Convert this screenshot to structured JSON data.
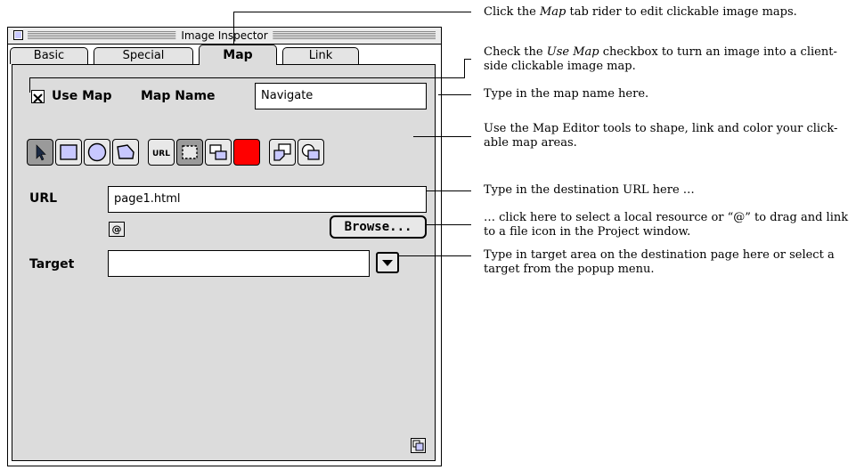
{
  "window": {
    "title": "Image Inspector"
  },
  "tabs": [
    {
      "label": "Basic",
      "active": false
    },
    {
      "label": "Special",
      "active": false
    },
    {
      "label": "Map",
      "active": true
    },
    {
      "label": "Link",
      "active": false
    }
  ],
  "map": {
    "use_map_label": "Use Map",
    "use_map_checked": true,
    "map_name_label": "Map Name",
    "map_name_value": "Navigate"
  },
  "tools": [
    {
      "icon": "arrow-pointer-icon",
      "selected": true
    },
    {
      "icon": "rectangle-icon",
      "selected": false
    },
    {
      "icon": "circle-icon",
      "selected": false
    },
    {
      "icon": "polygon-icon",
      "selected": false
    },
    {
      "icon": "url-icon",
      "label": "URL",
      "selected": false
    },
    {
      "icon": "marquee-icon",
      "selected": true
    },
    {
      "icon": "link-shapes-icon",
      "selected": false
    },
    {
      "icon": "color-swatch-icon",
      "color": "#ff0000",
      "selected": false
    },
    {
      "icon": "bring-to-front-icon",
      "selected": false
    },
    {
      "icon": "send-to-back-icon",
      "selected": false
    }
  ],
  "link": {
    "url_label": "URL",
    "url_value": "page1.html",
    "at_button_label": "@",
    "browse_label": "Browse...",
    "target_label": "Target",
    "target_value": ""
  },
  "callouts": {
    "c1_pre": "Click the ",
    "c1_em": "Map",
    "c1_post": " tab rider to edit clickable image maps.",
    "c2_pre": "Check the ",
    "c2_em": "Use Map",
    "c2_post": " checkbox to turn an image into a client-side clickable image map.",
    "c3": "Type in the map name here.",
    "c4": "Use the Map Editor tools to shape, link and color your click-able map areas.",
    "c5": "Type in the destination URL here …",
    "c6": "… click here to select a local resource or “@” to drag and link to a file icon in the Project window.",
    "c7": "Type in target area on the destination page here or select a target from the popup menu."
  }
}
